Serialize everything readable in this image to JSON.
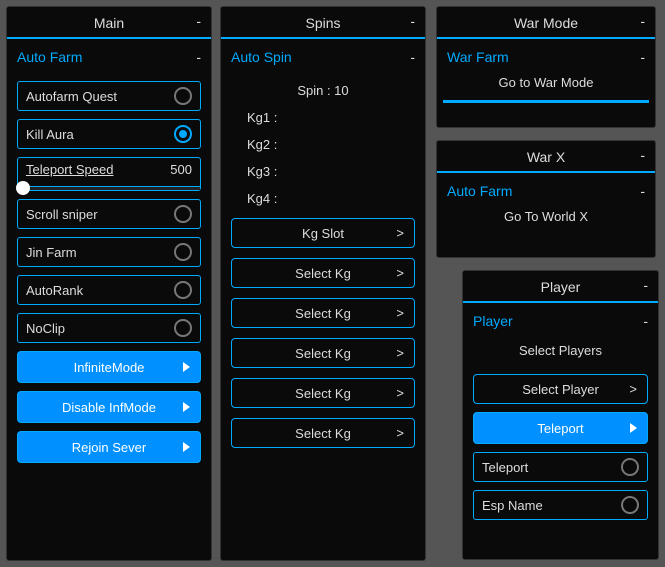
{
  "panels": {
    "main": {
      "title": "Main",
      "section": "Auto Farm",
      "rows": [
        {
          "label": "Autofarm Quest",
          "on": false
        },
        {
          "label": "Kill Aura",
          "on": true
        }
      ],
      "slider": {
        "label": "Teleport Speed",
        "value": "500"
      },
      "rows2": [
        {
          "label": "Scroll sniper",
          "on": false
        },
        {
          "label": "Jin Farm",
          "on": false
        },
        {
          "label": "AutoRank",
          "on": false
        },
        {
          "label": "NoClip",
          "on": false
        }
      ],
      "buttons": [
        {
          "label": "InfiniteMode"
        },
        {
          "label": "Disable InfMode"
        },
        {
          "label": "Rejoin Sever"
        }
      ]
    },
    "spins": {
      "title": "Spins",
      "section": "Auto Spin",
      "lines": [
        "Spin : 10",
        "Kg1 :",
        "Kg2 :",
        "Kg3 :",
        "Kg4 :"
      ],
      "selects": [
        "Kg Slot",
        "Select Kg",
        "Select Kg",
        "Select Kg",
        "Select Kg",
        "Select Kg"
      ]
    },
    "warmode": {
      "title": "War Mode",
      "section": "War Farm",
      "line": "Go to War Mode"
    },
    "warx": {
      "title": "War X",
      "section": "Auto Farm",
      "line": "Go To World X"
    },
    "player": {
      "title": "Player",
      "section": "Player",
      "line": "Select Players",
      "select": "Select Player",
      "btn": "Teleport",
      "toggles": [
        {
          "label": "Teleport",
          "on": false
        },
        {
          "label": "Esp Name",
          "on": false
        }
      ]
    }
  }
}
